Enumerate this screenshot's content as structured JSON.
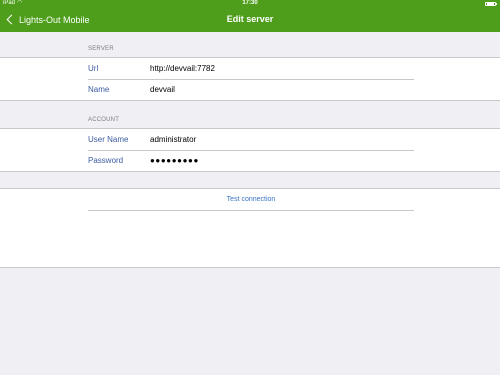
{
  "status_bar": {
    "carrier": "iPad",
    "time": "17:30"
  },
  "nav": {
    "back_label": "Lights-Out Mobile",
    "title": "Edit server",
    "color": "#4e9e1c"
  },
  "server_section": {
    "header": "SERVER",
    "url_label": "Url",
    "url_value": "http://devvail:7782",
    "name_label": "Name",
    "name_value": "devvail"
  },
  "account_section": {
    "header": "ACCOUNT",
    "username_label": "User Name",
    "username_value": "administrator",
    "password_label": "Password",
    "password_value": "●●●●●●●●●"
  },
  "actions": {
    "test_connection": "Test connection"
  },
  "icons": {
    "wifi": "wifi-icon",
    "battery": "battery-icon",
    "back": "chevron-left-icon"
  }
}
